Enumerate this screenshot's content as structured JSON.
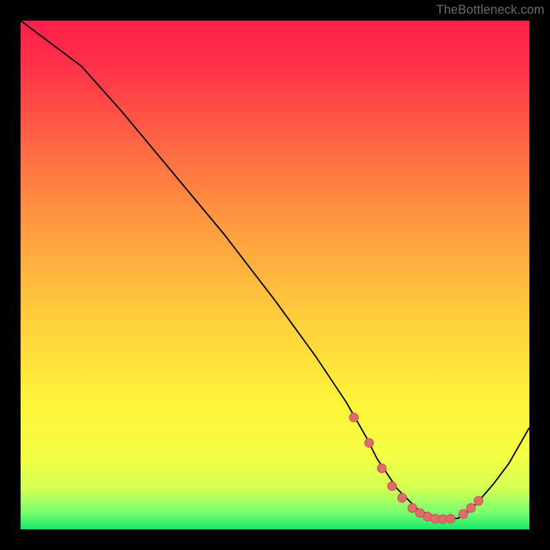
{
  "watermark": {
    "text": "TheBottleneck.com"
  },
  "colors": {
    "background": "#000000",
    "watermark": "#6a6a6a",
    "curve": "#000000",
    "marker_fill": "#e06b6b",
    "marker_stroke": "#c94f4f",
    "gradient_stops": [
      {
        "offset": 0.0,
        "color": "#ff1f4a"
      },
      {
        "offset": 0.1,
        "color": "#ff3449"
      },
      {
        "offset": 0.25,
        "color": "#ff6944"
      },
      {
        "offset": 0.43,
        "color": "#ffa340"
      },
      {
        "offset": 0.6,
        "color": "#ffd23c"
      },
      {
        "offset": 0.75,
        "color": "#fff33a"
      },
      {
        "offset": 0.86,
        "color": "#f3ff45"
      },
      {
        "offset": 0.92,
        "color": "#d4ff54"
      },
      {
        "offset": 0.965,
        "color": "#7dff6e"
      },
      {
        "offset": 1.0,
        "color": "#17e86a"
      }
    ]
  },
  "chart_data": {
    "type": "line",
    "title": "",
    "xlabel": "",
    "ylabel": "",
    "ylim": [
      0,
      100
    ],
    "series": [
      {
        "name": "bottleneck-curve",
        "x": [
          0,
          4,
          8,
          12,
          20,
          30,
          40,
          50,
          58,
          64,
          68,
          70,
          72,
          74,
          76,
          78,
          80,
          82,
          84,
          86,
          88,
          90,
          93,
          96,
          100
        ],
        "y": [
          100,
          97,
          94,
          91,
          82,
          70,
          58,
          45,
          34,
          25,
          18,
          14,
          11,
          8,
          6,
          4,
          3,
          2.2,
          2.0,
          2.2,
          3.5,
          5.5,
          9,
          13,
          20
        ]
      }
    ],
    "markers": {
      "name": "highlighted-points",
      "x": [
        65.5,
        68.5,
        71,
        73,
        75,
        77,
        78.5,
        80,
        81.5,
        83,
        84.5,
        87,
        88.5,
        90
      ],
      "y": [
        22,
        17,
        12,
        8.5,
        6.2,
        4.2,
        3.2,
        2.5,
        2.1,
        2.0,
        2.1,
        3.0,
        4.2,
        5.6
      ]
    }
  }
}
